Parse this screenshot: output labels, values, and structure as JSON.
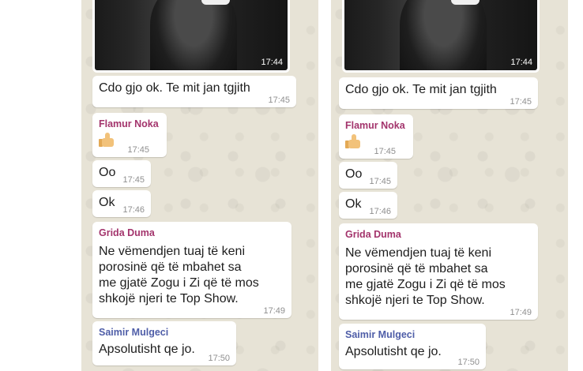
{
  "colors": {
    "flamur": "#a3346c",
    "grida": "#a3346c",
    "saimir": "#4f5ea8"
  },
  "panels": [
    {
      "photo_time": "17:44",
      "messages": [
        {
          "text": "Cdo gjo ok. Te mit jan tgjith",
          "time": "17:45"
        },
        {
          "sender": "Flamur Noka",
          "emoji": "thumbs-up",
          "time": "17:45"
        },
        {
          "text": "Oo",
          "time": "17:45"
        },
        {
          "text": "Ok",
          "time": "17:46"
        },
        {
          "sender": "Grida Duma",
          "lines": [
            "Ne vëmendjen tuaj të keni",
            "porosinë që të mbahet sa",
            "me gjatë Zogu i Zi që të mos",
            "shkojë njeri te Top Show."
          ],
          "time": "17:49"
        },
        {
          "sender": "Saimir Mulgeci",
          "text": "Apsolutisht qe jo.",
          "time": "17:50"
        }
      ]
    },
    {
      "photo_time": "17:44",
      "messages": [
        {
          "text": "Cdo gjo ok. Te mit jan tgjith",
          "time": "17:45"
        },
        {
          "sender": "Flamur Noka",
          "emoji": "thumbs-up",
          "time": "17:45"
        },
        {
          "text": "Oo",
          "time": "17:45"
        },
        {
          "text": "Ok",
          "time": "17:46"
        },
        {
          "sender": "Grida Duma",
          "lines": [
            "Ne vëmendjen tuaj të keni",
            "porosinë që të mbahet sa",
            "me gjatë Zogu i Zi që të mos",
            "shkojë njeri te Top Show."
          ],
          "time": "17:49"
        },
        {
          "sender": "Saimir Mulgeci",
          "text": "Apsolutisht qe jo.",
          "time": "17:50"
        }
      ]
    }
  ]
}
